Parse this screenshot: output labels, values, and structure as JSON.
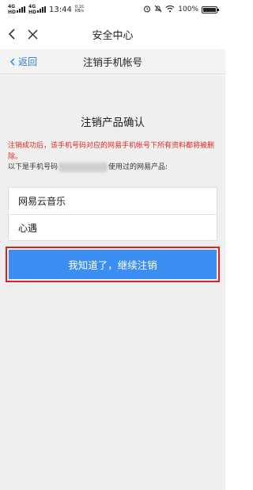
{
  "status_bar": {
    "signal1": "4G",
    "signal1_sub": "HD",
    "signal2": "4G",
    "signal2_sub": "HD",
    "time": "13:44",
    "speed": "0.10",
    "speed_unit": "KB/s",
    "battery": "100%",
    "battery_level": 1.0
  },
  "title_bar": {
    "title": "安全中心",
    "back_icon": "chevron-left-icon",
    "close_icon": "close-icon"
  },
  "sub_bar": {
    "back_label": "返回",
    "title": "注销手机帐号"
  },
  "main": {
    "confirm_title": "注销产品确认",
    "warning": "注销成功后，该手机号码对应的网易手机帐号下所有资料都将被删除。",
    "info_prefix": "以下是手机号码",
    "info_suffix": "使用过的网易产品:",
    "products": [
      "网易云音乐",
      "心遇"
    ],
    "continue_button": "我知道了，继续注销"
  },
  "colors": {
    "accent": "#3d8ef2",
    "link": "#2b7fd8",
    "warning": "#e0281e",
    "highlight_box": "#e02020",
    "background": "#efefef"
  }
}
